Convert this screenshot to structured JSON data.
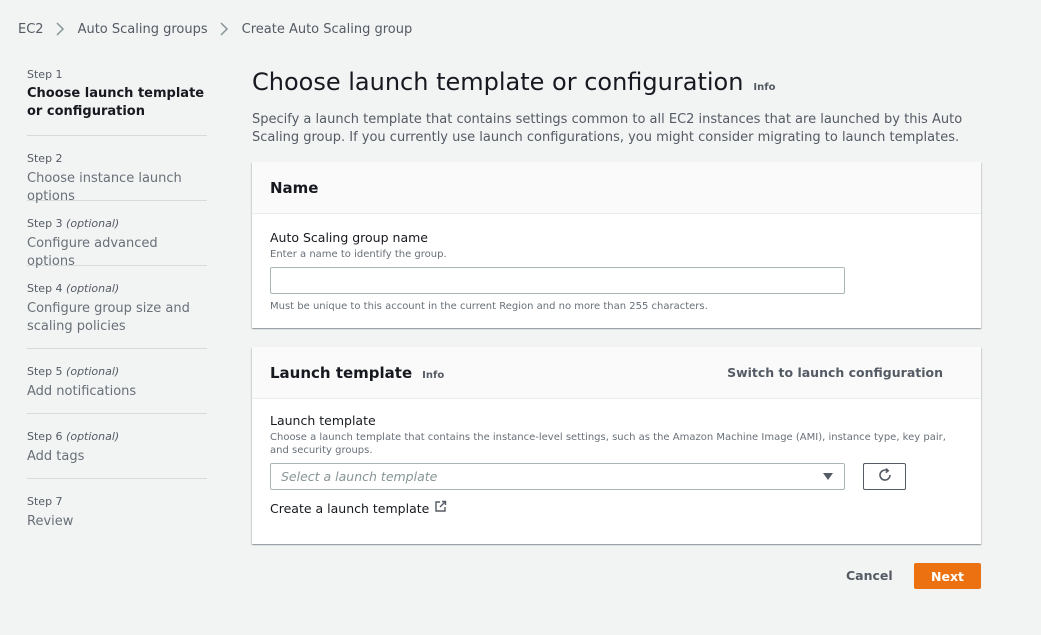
{
  "breadcrumb": {
    "items": [
      "EC2",
      "Auto Scaling groups",
      "Create Auto Scaling group"
    ]
  },
  "steps": [
    {
      "num": "Step 1",
      "optional": "",
      "title": "Choose launch template or configuration",
      "active": true
    },
    {
      "num": "Step 2",
      "optional": "",
      "title": "Choose instance launch options",
      "active": false
    },
    {
      "num": "Step 3",
      "optional": "(optional)",
      "title": "Configure advanced options",
      "active": false
    },
    {
      "num": "Step 4",
      "optional": "(optional)",
      "title": "Configure group size and scaling policies",
      "active": false
    },
    {
      "num": "Step 5",
      "optional": "(optional)",
      "title": "Add notifications",
      "active": false
    },
    {
      "num": "Step 6",
      "optional": "(optional)",
      "title": "Add tags",
      "active": false
    },
    {
      "num": "Step 7",
      "optional": "",
      "title": "Review",
      "active": false
    }
  ],
  "page": {
    "title": "Choose launch template or configuration",
    "info": "Info",
    "description": "Specify a launch template that contains settings common to all EC2 instances that are launched by this Auto Scaling group. If you currently use launch configurations, you might consider migrating to launch templates."
  },
  "name_panel": {
    "header": "Name",
    "field_label": "Auto Scaling group name",
    "field_desc": "Enter a name to identify the group.",
    "value": "",
    "placeholder": "",
    "constraint": "Must be unique to this account in the current Region and no more than 255 characters."
  },
  "launch_panel": {
    "header": "Launch template",
    "info": "Info",
    "switch_label": "Switch to launch configuration",
    "field_label": "Launch template",
    "field_desc": "Choose a launch template that contains the instance-level settings, such as the Amazon Machine Image (AMI), instance type, key pair, and security groups.",
    "select_placeholder": "Select a launch template",
    "create_link": "Create a launch template"
  },
  "footer": {
    "cancel": "Cancel",
    "next": "Next"
  },
  "colors": {
    "primary": "#ec7211",
    "background": "#f2f3f3",
    "text": "#16191f",
    "muted": "#545b64"
  },
  "icons": {
    "breadcrumb_separator": "chevron-right-icon",
    "dropdown": "caret-down-icon",
    "refresh": "refresh-icon",
    "external": "external-link-icon"
  }
}
